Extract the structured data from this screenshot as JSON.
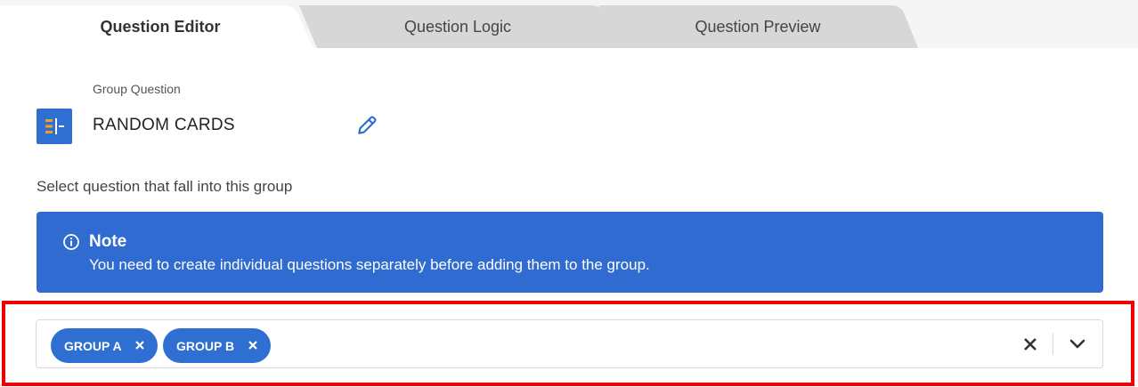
{
  "tabs": [
    {
      "label": "Question Editor",
      "active": true
    },
    {
      "label": "Question Logic",
      "active": false
    },
    {
      "label": "Question Preview",
      "active": false
    }
  ],
  "group": {
    "type_label": "Group Question",
    "name": "RANDOM CARDS",
    "icon": "group-list-icon",
    "edit_icon": "pencil-icon"
  },
  "select_label": "Select question that fall into this group",
  "note": {
    "icon": "info-circle-icon",
    "title": "Note",
    "text": "You need to create individual questions separately before adding them to the group."
  },
  "selected_groups": [
    {
      "label": "GROUP A"
    },
    {
      "label": "GROUP B"
    }
  ],
  "colors": {
    "accent": "#2f6fd1",
    "note_bg": "#2f6bd0",
    "highlight": "#ee0000"
  }
}
